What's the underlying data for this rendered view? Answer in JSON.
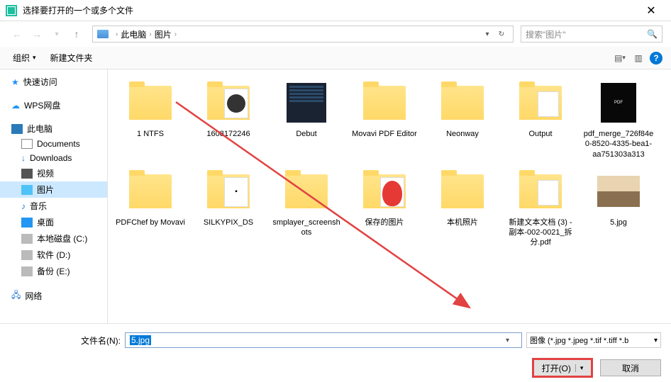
{
  "title": "选择要打开的一个或多个文件",
  "breadcrumb": {
    "root": "此电脑",
    "current": "图片"
  },
  "search": {
    "placeholder": "搜索\"图片\""
  },
  "toolbar": {
    "organize": "组织",
    "newfolder": "新建文件夹"
  },
  "sidebar": {
    "quick": "快速访问",
    "wps": "WPS网盘",
    "thispc": "此电脑",
    "docs": "Documents",
    "downloads": "Downloads",
    "videos": "视频",
    "pictures": "图片",
    "music": "音乐",
    "desktop": "桌面",
    "diskc": "本地磁盘 (C:)",
    "diskd": "软件 (D:)",
    "diske": "备份 (E:)",
    "network": "网络"
  },
  "items": [
    {
      "name": "1 NTFS",
      "kind": "folder"
    },
    {
      "name": "1608172246",
      "kind": "folder-face"
    },
    {
      "name": "Debut",
      "kind": "debut"
    },
    {
      "name": "Movavi PDF Editor",
      "kind": "folder"
    },
    {
      "name": "Neonway",
      "kind": "folder"
    },
    {
      "name": "Output",
      "kind": "folder-doc"
    },
    {
      "name": "pdf_merge_726f84e0-8520-4335-bea1-aa751303a313",
      "kind": "pdf"
    },
    {
      "name": "PDFChef by Movavi",
      "kind": "folder"
    },
    {
      "name": "SILKYPIX_DS",
      "kind": "folder-silky"
    },
    {
      "name": "smplayer_screenshots",
      "kind": "folder"
    },
    {
      "name": "保存的图片",
      "kind": "folder-strawb"
    },
    {
      "name": "本机照片",
      "kind": "folder"
    },
    {
      "name": "新建文本文档 (3) - 副本-002-0021_拆分.pdf",
      "kind": "folder-doc"
    },
    {
      "name": "5.jpg",
      "kind": "sunset"
    }
  ],
  "filename": {
    "label": "文件名(N):",
    "value": "5.jpg"
  },
  "filter": "图像 (*.jpg *.jpeg *.tif *.tiff *.b",
  "buttons": {
    "open": "打开(O)",
    "cancel": "取消"
  }
}
